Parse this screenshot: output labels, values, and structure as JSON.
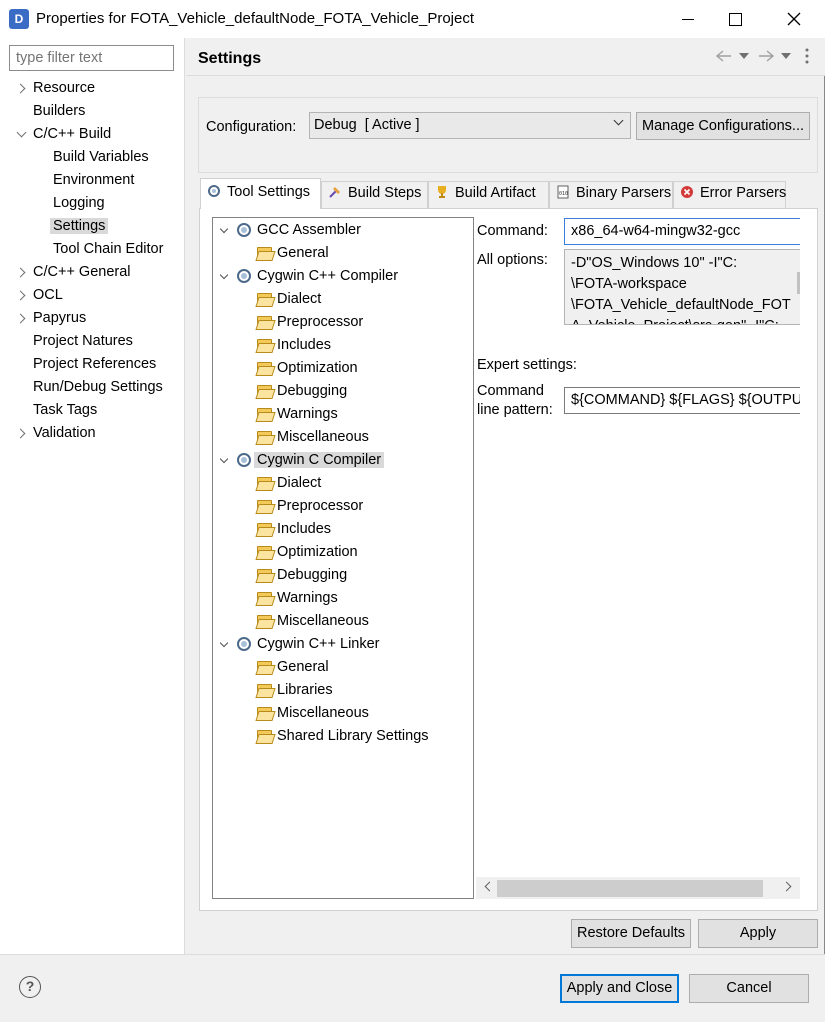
{
  "window": {
    "title": "Properties for FOTA_Vehicle_defaultNode_FOTA_Vehicle_Project",
    "app_icon_letter": "D"
  },
  "left": {
    "filter_placeholder": "type filter text",
    "items": [
      {
        "label": "Resource",
        "expander": "right",
        "indent": 0
      },
      {
        "label": "Builders",
        "expander": "none",
        "indent": 0
      },
      {
        "label": "C/C++ Build",
        "expander": "down",
        "indent": 0
      },
      {
        "label": "Build Variables",
        "expander": "none",
        "indent": 1
      },
      {
        "label": "Environment",
        "expander": "none",
        "indent": 1
      },
      {
        "label": "Logging",
        "expander": "none",
        "indent": 1
      },
      {
        "label": "Settings",
        "expander": "none",
        "indent": 1,
        "selected": true
      },
      {
        "label": "Tool Chain Editor",
        "expander": "none",
        "indent": 1
      },
      {
        "label": "C/C++ General",
        "expander": "right",
        "indent": 0
      },
      {
        "label": "OCL",
        "expander": "right",
        "indent": 0
      },
      {
        "label": "Papyrus",
        "expander": "right",
        "indent": 0
      },
      {
        "label": "Project Natures",
        "expander": "none",
        "indent": 0
      },
      {
        "label": "Project References",
        "expander": "none",
        "indent": 0
      },
      {
        "label": "Run/Debug Settings",
        "expander": "none",
        "indent": 0
      },
      {
        "label": "Task Tags",
        "expander": "none",
        "indent": 0
      },
      {
        "label": "Validation",
        "expander": "right",
        "indent": 0
      }
    ]
  },
  "header": {
    "title": "Settings",
    "icons": [
      "back-arrow-icon",
      "dropdown-icon",
      "forward-arrow-icon",
      "dropdown-icon",
      "more-icon"
    ]
  },
  "config": {
    "label": "Configuration:",
    "value": "Debug  [ Active ]",
    "manage_label": "Manage Configurations..."
  },
  "tabs": [
    {
      "label": "Tool Settings",
      "icon": "tool-settings-icon",
      "active": true
    },
    {
      "label": "Build Steps",
      "icon": "build-steps-icon"
    },
    {
      "label": "Build Artifact",
      "icon": "build-artifact-icon"
    },
    {
      "label": "Binary Parsers",
      "icon": "binary-parsers-icon"
    },
    {
      "label": "Error Parsers",
      "icon": "error-parsers-icon"
    }
  ],
  "tree": [
    {
      "label": "GCC Assembler",
      "level": 0
    },
    {
      "label": "General",
      "level": 1
    },
    {
      "label": "Cygwin C++ Compiler",
      "level": 0
    },
    {
      "label": "Dialect",
      "level": 1
    },
    {
      "label": "Preprocessor",
      "level": 1
    },
    {
      "label": "Includes",
      "level": 1
    },
    {
      "label": "Optimization",
      "level": 1
    },
    {
      "label": "Debugging",
      "level": 1
    },
    {
      "label": "Warnings",
      "level": 1
    },
    {
      "label": "Miscellaneous",
      "level": 1
    },
    {
      "label": "Cygwin C Compiler",
      "level": 0,
      "selected": true
    },
    {
      "label": "Dialect",
      "level": 1
    },
    {
      "label": "Preprocessor",
      "level": 1
    },
    {
      "label": "Includes",
      "level": 1
    },
    {
      "label": "Optimization",
      "level": 1
    },
    {
      "label": "Debugging",
      "level": 1
    },
    {
      "label": "Warnings",
      "level": 1
    },
    {
      "label": "Miscellaneous",
      "level": 1
    },
    {
      "label": "Cygwin C++ Linker",
      "level": 0
    },
    {
      "label": "General",
      "level": 1
    },
    {
      "label": "Libraries",
      "level": 1
    },
    {
      "label": "Miscellaneous",
      "level": 1
    },
    {
      "label": "Shared Library Settings",
      "level": 1
    }
  ],
  "details": {
    "command_label": "Command:",
    "command_value": "x86_64-w64-mingw32-gcc",
    "all_options_label": "All options:",
    "all_options_lines": [
      "-D\"OS_Windows 10\" -I\"C:",
      "\\FOTA-workspace",
      "\\FOTA_Vehicle_defaultNode_FOT",
      "A_Vehicle_Project\\src-gen\" -I\"C:"
    ],
    "expert_label": "Expert settings:",
    "cmdline_label_1": "Command",
    "cmdline_label_2": "line pattern:",
    "cmdline_value": "${COMMAND} ${FLAGS} ${OUTPUT"
  },
  "buttons": {
    "restore": "Restore Defaults",
    "apply": "Apply",
    "apply_close": "Apply and Close",
    "cancel": "Cancel",
    "help_glyph": "?"
  },
  "colors": {
    "focus_blue": "#0078d7",
    "selection_gray": "#d9d9d9"
  }
}
